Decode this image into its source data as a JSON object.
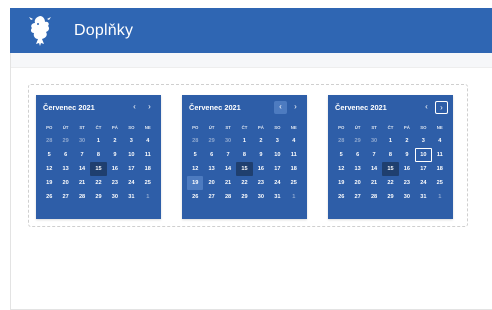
{
  "header": {
    "title": "Doplňky",
    "logo_icon": "heraldic-lion-icon",
    "background": "#2f66b3"
  },
  "calendars": [
    {
      "month_label": "Červenec 2021",
      "prev_icon": "‹",
      "next_icon": "›",
      "highlight_nav": "none",
      "today": "15",
      "hover_day": "",
      "focus_day": ""
    },
    {
      "month_label": "Červenec 2021",
      "prev_icon": "‹",
      "next_icon": "›",
      "highlight_nav": "prev",
      "today": "15",
      "hover_day": "19",
      "focus_day": ""
    },
    {
      "month_label": "Červenec 2021",
      "prev_icon": "‹",
      "next_icon": "›",
      "highlight_nav": "next",
      "today": "15",
      "hover_day": "",
      "focus_day": "10"
    }
  ],
  "weekdays": [
    "PO",
    "ÚT",
    "ST",
    "ČT",
    "PÁ",
    "SO",
    "NE"
  ],
  "weeks": [
    [
      "28",
      "29",
      "30",
      "1",
      "2",
      "3",
      "4"
    ],
    [
      "5",
      "6",
      "7",
      "8",
      "9",
      "10",
      "11"
    ],
    [
      "12",
      "13",
      "14",
      "15",
      "16",
      "17",
      "18"
    ],
    [
      "19",
      "20",
      "21",
      "22",
      "23",
      "24",
      "25"
    ],
    [
      "26",
      "27",
      "28",
      "29",
      "30",
      "31",
      "1"
    ]
  ],
  "muted_cells": [
    [
      0,
      0
    ],
    [
      0,
      1
    ],
    [
      0,
      2
    ],
    [
      4,
      6
    ]
  ],
  "colors": {
    "calendar_bg": "#2e5ea8",
    "today_bg": "#1f3f6f",
    "hover_bg": "#4d7bc0"
  }
}
